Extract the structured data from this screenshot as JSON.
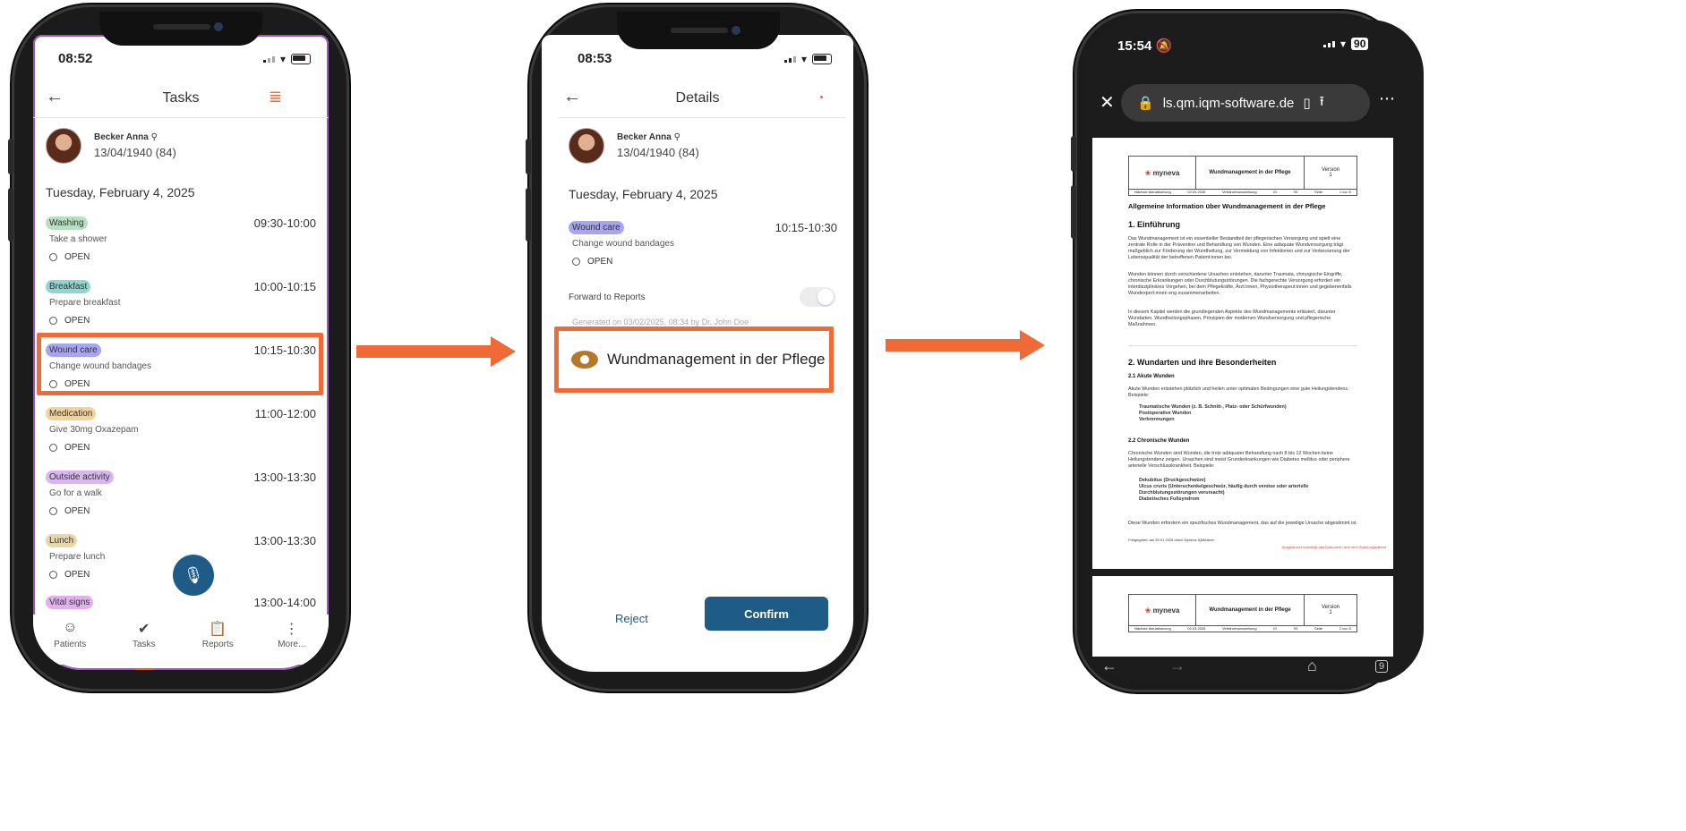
{
  "phone1": {
    "time": "08:52",
    "title": "Tasks",
    "patient_name": "Becker Anna",
    "patient_dob": "13/04/1940 (84)",
    "date": "Tuesday, February 4, 2025",
    "tasks": [
      {
        "category": "Washing",
        "time": "09:30-10:00",
        "desc": "Take a shower",
        "status": "OPEN",
        "color": "#b9dfc2"
      },
      {
        "category": "Breakfast",
        "time": "10:00-10:15",
        "desc": "Prepare breakfast",
        "status": "OPEN",
        "color": "#8fd6cf"
      },
      {
        "category": "Wound care",
        "time": "10:15-10:30",
        "desc": "Change wound bandages",
        "status": "OPEN",
        "color": "#a7a5f2"
      },
      {
        "category": "Medication",
        "time": "11:00-12:00",
        "desc": "Give 30mg Oxazepam",
        "status": "OPEN",
        "color": "#f3d39a"
      },
      {
        "category": "Outside activity",
        "time": "13:00-13:30",
        "desc": "Go for a walk",
        "status": "OPEN",
        "color": "#d8b6ee"
      },
      {
        "category": "Lunch",
        "time": "13:00-13:30",
        "desc": "Prepare lunch",
        "status": "OPEN",
        "color": "#e9d7a7"
      },
      {
        "category": "Vital signs",
        "time": "13:00-14:00",
        "desc": "",
        "status": "",
        "color": "#dfb2ee"
      }
    ],
    "nav": [
      "Patients",
      "Tasks",
      "Reports",
      "More..."
    ]
  },
  "phone2": {
    "time": "08:53",
    "title": "Details",
    "patient_name": "Becker Anna",
    "patient_dob": "13/04/1940 (84)",
    "date": "Tuesday, February 4, 2025",
    "task_category": "Wound care",
    "task_time": "10:15-10:30",
    "task_desc": "Change wound bandages",
    "task_status": "OPEN",
    "forward_label": "Forward to Reports",
    "generated": "Generated on 03/02/2025, 08:34 by Dr. John Doe",
    "doc_link": "Wundmanagement in der Pflege",
    "reject": "Reject",
    "confirm": "Confirm"
  },
  "phone3": {
    "time": "15:54",
    "battery": "90",
    "url": "ls.qm.iqm-software.de",
    "tabs_count": "9",
    "doc": {
      "brand": "myneva",
      "title": "Wundmanagement in der Pflege",
      "version_label": "Version",
      "version": "1",
      "next_update_label": "Nächste Aktualisierung",
      "next_update": "02.03.2026",
      "doc_type": "Verfahrensanweisung",
      "id_label": "ID",
      "id": "93",
      "page_label": "Seite",
      "page": "1 von 5",
      "page2": "2 von 5",
      "heading": "Allgemeine Information über Wundmanagement in der Pflege",
      "h1": "1. Einführung",
      "p1": "Das Wundmanagement ist ein essentieller Bestandteil der pflegerischen Versorgung und spielt eine zentrale Rolle in der Prävention und Behandlung von Wunden. Eine adäquate Wundversorgung trägt maßgeblich zur Förderung der Wundheilung, zur Vermeidung von Infektionen und zur Verbesserung der Lebensqualität der betroffenen Patient:innen bei.",
      "p2": "Wunden können durch verschiedene Ursachen entstehen, darunter Traumata, chirurgische Eingriffe, chronische Erkrankungen oder Durchblutungsstörungen. Die fachgerechte Versorgung erfordert ein interdisziplinäres Vorgehen, bei dem Pflegekräfte, Ärzt:innen, Physiotherapeut:innen und gegebenenfalls Wundexpert:innen eng zusammenarbeiten.",
      "p3": "In diesem Kapitel werden die grundlegenden Aspekte des Wundmanagements erläutert, darunter Wundarten, Wundheilungsphasen, Prinzipien der modernen Wundversorgung und pflegerische Maßnahmen.",
      "h2": "2. Wundarten und ihre Besonderheiten",
      "h21": "2.1 Akute Wunden",
      "p21": "Akute Wunden entstehen plötzlich und heilen unter optimalen Bedingungen eine gute Heilungstendenz. Beispiele:",
      "l21": [
        "Traumatische Wunden (z. B. Schnitt-, Platz- oder Schürfwunden)",
        "Postoperative Wunden",
        "Verbrennungen"
      ],
      "h22": "2.2 Chronische Wunden",
      "p22": "Chronische Wunden sind Wunden, die trotz adäquater Behandlung nach 8 bis 12 Wochen keine Heilungstendenz zeigen. Ursachen sind meist Grunderkrankungen wie Diabetes mellitus oder periphere arterielle Verschlusskrankheit. Beispiele:",
      "l22": [
        "Dekubitus (Druckgeschwüre)",
        "Ulcus cruris (Unterschenkelgeschwür, häufig durch venöse oder arterielle Durchblutungsstörungen verursacht)",
        "Diabetisches Fußsyndrom"
      ],
      "p23": "Diese Wunden erfordern ein spezifisches Wundmanagement, das auf die jeweilige Ursache abgestimmt ist.",
      "footer_left": "Freigegeben am 30.01.2025 durch Myneva IQMAdmin",
      "footer_right": "Ausgedruckt unterliegt das Dokument nicht dem Änderungsdienst"
    }
  },
  "colors": {
    "accent": "#ef6a36",
    "primary": "#1e5c87",
    "frame": "#1b1b1b"
  }
}
